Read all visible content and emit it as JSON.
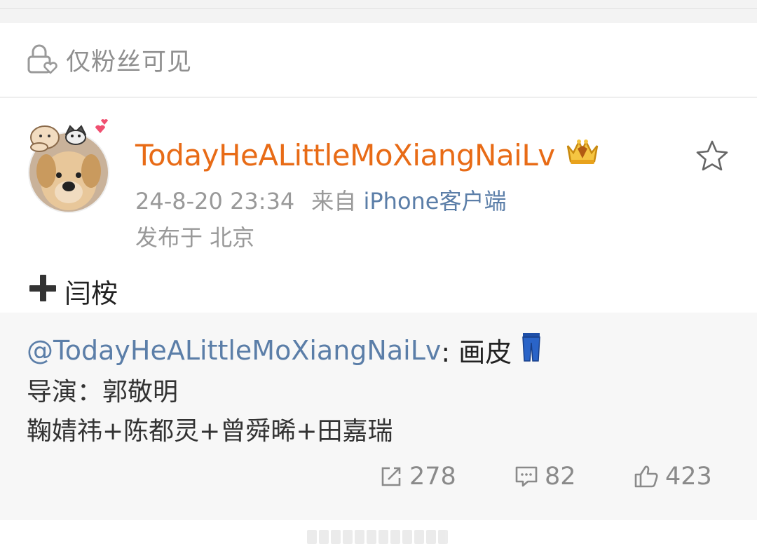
{
  "visibility": {
    "label": "仅粉丝可见"
  },
  "post": {
    "username": "TodayHeALittleMoXiangNaiLv",
    "time": "24-8-20 23:34",
    "source_prefix": "来自",
    "source": "iPhone客户端",
    "location": "发布于 北京",
    "text": "闫桉"
  },
  "repost": {
    "mention": "@TodayHeALittleMoXiangNaiLv",
    "title_suffix": ": 画皮",
    "director": "导演：郭敬明",
    "cast": "鞠婧祎+陈都灵+曾舜晞+田嘉瑞"
  },
  "actions": {
    "reposts": "278",
    "comments": "82",
    "likes": "423"
  },
  "colors": {
    "username": "#e86b16",
    "link": "#5b7ea8",
    "muted": "#999999"
  }
}
